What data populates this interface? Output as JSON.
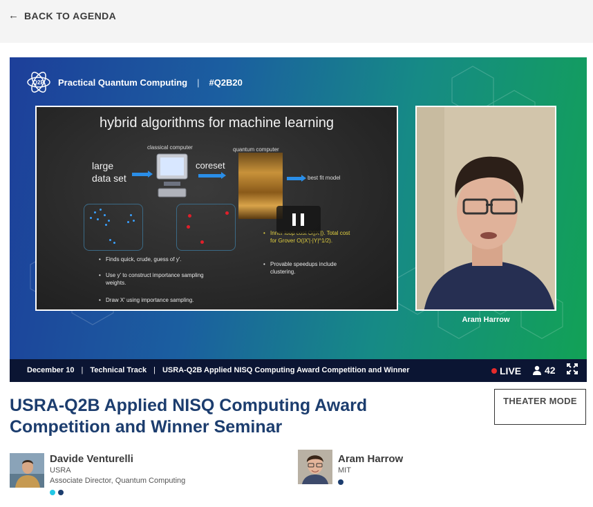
{
  "nav": {
    "back_label": "BACK TO AGENDA"
  },
  "player": {
    "brand_name": "Practical Quantum Computing",
    "brand_sep": "|",
    "brand_hashtag": "#Q2B20",
    "logo_text": "Q2B",
    "slide": {
      "title": "hybrid algorithms for machine learning",
      "large_data_set": "large data set",
      "classical_computer": "classical computer",
      "quantum_computer": "quantum computer",
      "coreset": "coreset",
      "best_fit_model": "best fit model",
      "bullets_left": [
        "Finds quick, crude, guess of y'.",
        "Use y' to construct importance sampling weights.",
        "Draw X' using importance sampling."
      ],
      "bullets_right": [
        "Inner loop cost O(|X'|). Total cost for Grover O(|X'|·|Y|^1/2).",
        "Provable speedups include clustering."
      ]
    },
    "camera_name": "Aram Harrow",
    "controls": {
      "date": "December 10",
      "track": "Technical Track",
      "session": "USRA-Q2B Applied NISQ Computing Award Competition and Winner",
      "separator": "|",
      "live_label": "LIVE",
      "viewer_count": "42"
    }
  },
  "session": {
    "title": "USRA-Q2B Applied NISQ Computing Award Competition and Winner Seminar",
    "theater_button": "THEATER MODE"
  },
  "speakers": [
    {
      "name": "Davide Venturelli",
      "org": "USRA",
      "role": "Associate Director, Quantum Computing",
      "dots": [
        "#23c8e6",
        "#1c3d6e"
      ]
    },
    {
      "name": "Aram Harrow",
      "org": "MIT",
      "role": "",
      "dots": [
        "#1c3d6e"
      ]
    }
  ],
  "colors": {
    "accent": "#1c3d6e",
    "live": "#e52b2b",
    "bar_bg": "#0b1533"
  }
}
